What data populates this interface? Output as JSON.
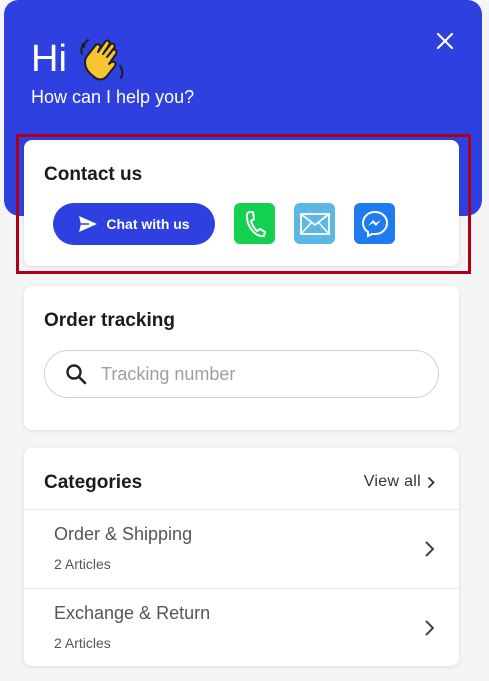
{
  "header": {
    "greeting": "Hi",
    "subtitle": "How can I help you?",
    "background": "#2e40e0"
  },
  "contact": {
    "title": "Contact us",
    "chat_label": "Chat with us",
    "channels": [
      {
        "name": "phone-icon",
        "color": "#12d14e"
      },
      {
        "name": "mail-icon",
        "color": "#5db7e6"
      },
      {
        "name": "messenger-icon",
        "color": "#1f7bf2"
      }
    ]
  },
  "order_tracking": {
    "title": "Order tracking",
    "placeholder": "Tracking number",
    "value": ""
  },
  "categories": {
    "title": "Categories",
    "view_all": "View all",
    "items": [
      {
        "name": "Order & Shipping",
        "count": "2 Articles"
      },
      {
        "name": "Exchange & Return",
        "count": "2 Articles"
      }
    ]
  },
  "colors": {
    "accent": "#2e40e0",
    "highlight_border": "#b00018"
  }
}
